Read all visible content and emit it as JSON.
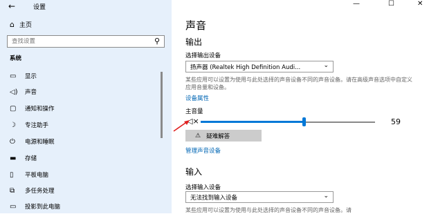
{
  "window": {
    "title": "设置",
    "controls": {
      "minimize": "—",
      "maximize": "☐",
      "close": "✕"
    }
  },
  "sidebar": {
    "back": "←",
    "home_label": "主页",
    "search": {
      "placeholder": "查找设置"
    },
    "section_title": "系统",
    "items": [
      {
        "label": "显示",
        "icon": "monitor-icon",
        "glyph": "▭"
      },
      {
        "label": "声音",
        "icon": "speaker-icon",
        "glyph": "◁)"
      },
      {
        "label": "通知和操作",
        "icon": "notification-icon",
        "glyph": "▢"
      },
      {
        "label": "专注助手",
        "icon": "moon-icon",
        "glyph": "☽"
      },
      {
        "label": "电源和睡眠",
        "icon": "power-icon",
        "glyph": "⏻"
      },
      {
        "label": "存储",
        "icon": "storage-icon",
        "glyph": "▬"
      },
      {
        "label": "平板电脑",
        "icon": "tablet-icon",
        "glyph": "▯"
      },
      {
        "label": "多任务处理",
        "icon": "multitask-icon",
        "glyph": "⧉"
      },
      {
        "label": "投影到此电脑",
        "icon": "project-icon",
        "glyph": "▭"
      }
    ],
    "active_index": 1
  },
  "main": {
    "title": "声音",
    "output": {
      "heading": "输出",
      "device_label": "选择输出设备",
      "device_value": "扬声器 (Realtek High Definition Audi...",
      "description": "某些应用可以设置为使用与此处选择的声音设备不同的声音设备。请在高级声音选项中自定义应用音量和设备。",
      "properties_link": "设备属性",
      "volume_label": "主音量",
      "volume_value": "59",
      "volume_fraction": 0.59,
      "troubleshoot_label": "疑难解答",
      "manage_link": "管理声音设备"
    },
    "input": {
      "heading": "输入",
      "device_label": "选择输入设备",
      "device_value": "无法找到输入设备",
      "description": "某些应用可以设置为使用与此处选择的声音设备不同的声音设备。请"
    }
  },
  "colors": {
    "accent": "#0078d7",
    "sidebar_bg": "#e6f0fb",
    "link": "#0066b4",
    "arrow": "#e02020"
  }
}
